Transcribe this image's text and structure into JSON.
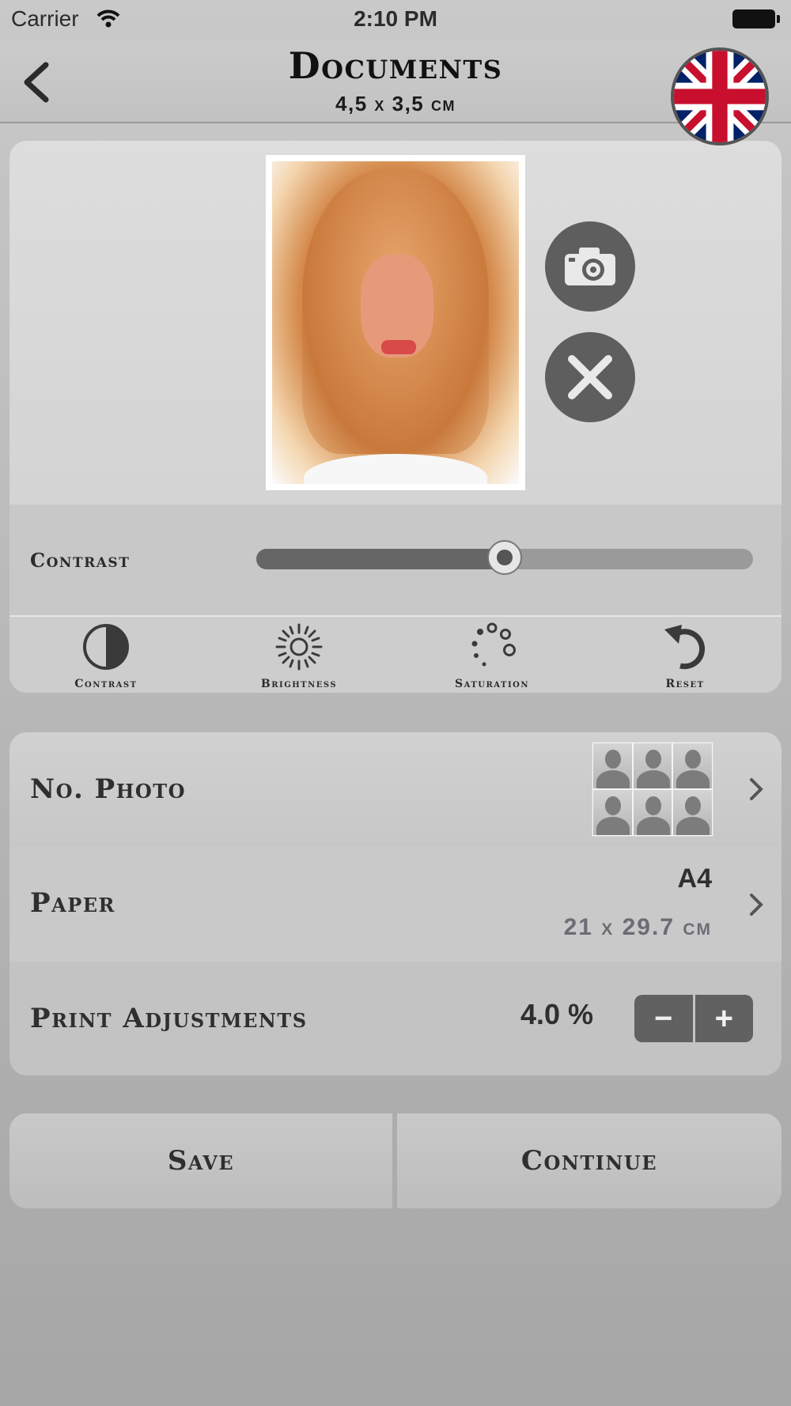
{
  "status_bar": {
    "carrier": "Carrier",
    "time": "2:10 PM"
  },
  "nav": {
    "title": "Documents",
    "subtitle": "4,5 x 3,5 cm",
    "language": "uk-flag-icon"
  },
  "editor": {
    "contrast_label": "Contrast",
    "contrast_level": 0.5,
    "tools": [
      {
        "label": "Contrast",
        "icon": "contrast-icon"
      },
      {
        "label": "Brightness",
        "icon": "brightness-icon"
      },
      {
        "label": "Saturation",
        "icon": "saturation-icon"
      },
      {
        "label": "Reset",
        "icon": "reset-icon"
      }
    ]
  },
  "settings": {
    "photos_label": "No. Photo",
    "photos_count": 6,
    "paper_label": "Paper",
    "paper_size": "A4",
    "paper_dims": "21 x 29.7 cm",
    "adjust_label": "Print Adjustments",
    "adjust_value": "4.0 %",
    "minus": "−",
    "plus": "+"
  },
  "actions": {
    "save": "Save",
    "continue": "Continue"
  },
  "colors": {
    "button_dark": "#5e5e5e",
    "text": "#2f2f2f",
    "subtle_text": "#6c6c75"
  }
}
